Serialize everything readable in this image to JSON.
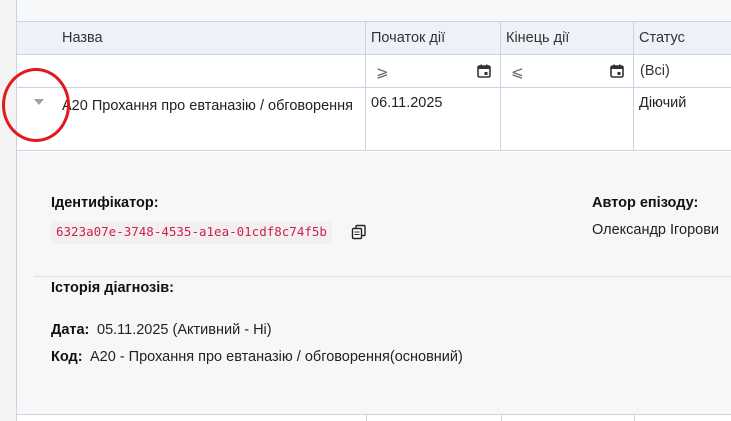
{
  "columns": {
    "name": "Назва",
    "start": "Початок дії",
    "end": "Кінець дії",
    "status": "Статус"
  },
  "filters": {
    "start_op": "⩾",
    "end_op": "⩽",
    "status_value": "(Всі)"
  },
  "row": {
    "name": "A20 Прохання про евтаназію / обговорення",
    "start": "06.11.2025",
    "end": "",
    "status": "Діючий"
  },
  "detail": {
    "identifier_label": "Ідентифікатор:",
    "identifier_value": "6323a07e-3748-4535-a1ea-01cdf8c74f5b",
    "author_label": "Автор епізоду:",
    "author_value": "Олександр Ігорови",
    "history_label": "Історія діагнозів:",
    "date_label": "Дата:",
    "date_value": "05.11.2025 (Активний - Ні)",
    "code_label": "Код:",
    "code_value": "A20 - Прохання про евтаназію / обговорення(основний)"
  },
  "colors": {
    "grid_border": "#c7d3e6",
    "header_bg": "#eef2f8",
    "highlight": "#e0191d",
    "uuid_text": "#c7254e"
  },
  "icons": [
    "calendar-icon",
    "copy-icon",
    "chevron-down-icon"
  ]
}
